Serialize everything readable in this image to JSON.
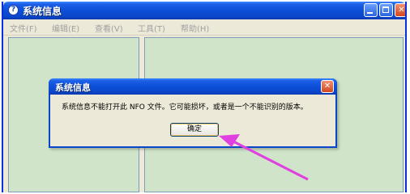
{
  "window": {
    "title": "系统信息",
    "icon": "help-circle-icon"
  },
  "menubar": {
    "items": [
      {
        "label": "文件(F)"
      },
      {
        "label": "编辑(E)"
      },
      {
        "label": "查看(V)"
      },
      {
        "label": "工具(T)"
      },
      {
        "label": "帮助(H)"
      }
    ]
  },
  "dialog": {
    "title": "系统信息",
    "message": "系统信息不能打开此 NFO 文件。它可能损坏，或者是一个不能识别的版本。",
    "ok_label": "确定"
  },
  "annotation": {
    "arrow_color": "#e040e0"
  },
  "colors": {
    "titlebar": "#0a46c9",
    "pane_background": "#cfe4c8",
    "window_background": "#ece9d8"
  }
}
